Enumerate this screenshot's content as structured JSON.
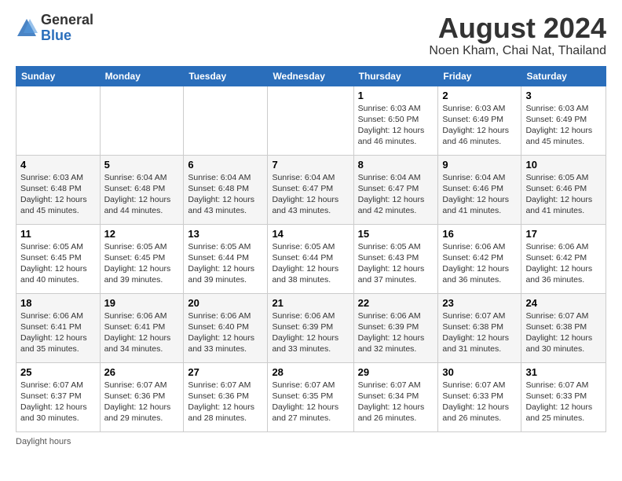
{
  "logo": {
    "general": "General",
    "blue": "Blue"
  },
  "title": "August 2024",
  "location": "Noen Kham, Chai Nat, Thailand",
  "days_of_week": [
    "Sunday",
    "Monday",
    "Tuesday",
    "Wednesday",
    "Thursday",
    "Friday",
    "Saturday"
  ],
  "footer": "Daylight hours",
  "weeks": [
    [
      {
        "day": "",
        "detail": ""
      },
      {
        "day": "",
        "detail": ""
      },
      {
        "day": "",
        "detail": ""
      },
      {
        "day": "",
        "detail": ""
      },
      {
        "day": "1",
        "detail": "Sunrise: 6:03 AM\nSunset: 6:50 PM\nDaylight: 12 hours\nand 46 minutes."
      },
      {
        "day": "2",
        "detail": "Sunrise: 6:03 AM\nSunset: 6:49 PM\nDaylight: 12 hours\nand 46 minutes."
      },
      {
        "day": "3",
        "detail": "Sunrise: 6:03 AM\nSunset: 6:49 PM\nDaylight: 12 hours\nand 45 minutes."
      }
    ],
    [
      {
        "day": "4",
        "detail": "Sunrise: 6:03 AM\nSunset: 6:48 PM\nDaylight: 12 hours\nand 45 minutes."
      },
      {
        "day": "5",
        "detail": "Sunrise: 6:04 AM\nSunset: 6:48 PM\nDaylight: 12 hours\nand 44 minutes."
      },
      {
        "day": "6",
        "detail": "Sunrise: 6:04 AM\nSunset: 6:48 PM\nDaylight: 12 hours\nand 43 minutes."
      },
      {
        "day": "7",
        "detail": "Sunrise: 6:04 AM\nSunset: 6:47 PM\nDaylight: 12 hours\nand 43 minutes."
      },
      {
        "day": "8",
        "detail": "Sunrise: 6:04 AM\nSunset: 6:47 PM\nDaylight: 12 hours\nand 42 minutes."
      },
      {
        "day": "9",
        "detail": "Sunrise: 6:04 AM\nSunset: 6:46 PM\nDaylight: 12 hours\nand 41 minutes."
      },
      {
        "day": "10",
        "detail": "Sunrise: 6:05 AM\nSunset: 6:46 PM\nDaylight: 12 hours\nand 41 minutes."
      }
    ],
    [
      {
        "day": "11",
        "detail": "Sunrise: 6:05 AM\nSunset: 6:45 PM\nDaylight: 12 hours\nand 40 minutes."
      },
      {
        "day": "12",
        "detail": "Sunrise: 6:05 AM\nSunset: 6:45 PM\nDaylight: 12 hours\nand 39 minutes."
      },
      {
        "day": "13",
        "detail": "Sunrise: 6:05 AM\nSunset: 6:44 PM\nDaylight: 12 hours\nand 39 minutes."
      },
      {
        "day": "14",
        "detail": "Sunrise: 6:05 AM\nSunset: 6:44 PM\nDaylight: 12 hours\nand 38 minutes."
      },
      {
        "day": "15",
        "detail": "Sunrise: 6:05 AM\nSunset: 6:43 PM\nDaylight: 12 hours\nand 37 minutes."
      },
      {
        "day": "16",
        "detail": "Sunrise: 6:06 AM\nSunset: 6:42 PM\nDaylight: 12 hours\nand 36 minutes."
      },
      {
        "day": "17",
        "detail": "Sunrise: 6:06 AM\nSunset: 6:42 PM\nDaylight: 12 hours\nand 36 minutes."
      }
    ],
    [
      {
        "day": "18",
        "detail": "Sunrise: 6:06 AM\nSunset: 6:41 PM\nDaylight: 12 hours\nand 35 minutes."
      },
      {
        "day": "19",
        "detail": "Sunrise: 6:06 AM\nSunset: 6:41 PM\nDaylight: 12 hours\nand 34 minutes."
      },
      {
        "day": "20",
        "detail": "Sunrise: 6:06 AM\nSunset: 6:40 PM\nDaylight: 12 hours\nand 33 minutes."
      },
      {
        "day": "21",
        "detail": "Sunrise: 6:06 AM\nSunset: 6:39 PM\nDaylight: 12 hours\nand 33 minutes."
      },
      {
        "day": "22",
        "detail": "Sunrise: 6:06 AM\nSunset: 6:39 PM\nDaylight: 12 hours\nand 32 minutes."
      },
      {
        "day": "23",
        "detail": "Sunrise: 6:07 AM\nSunset: 6:38 PM\nDaylight: 12 hours\nand 31 minutes."
      },
      {
        "day": "24",
        "detail": "Sunrise: 6:07 AM\nSunset: 6:38 PM\nDaylight: 12 hours\nand 30 minutes."
      }
    ],
    [
      {
        "day": "25",
        "detail": "Sunrise: 6:07 AM\nSunset: 6:37 PM\nDaylight: 12 hours\nand 30 minutes."
      },
      {
        "day": "26",
        "detail": "Sunrise: 6:07 AM\nSunset: 6:36 PM\nDaylight: 12 hours\nand 29 minutes."
      },
      {
        "day": "27",
        "detail": "Sunrise: 6:07 AM\nSunset: 6:36 PM\nDaylight: 12 hours\nand 28 minutes."
      },
      {
        "day": "28",
        "detail": "Sunrise: 6:07 AM\nSunset: 6:35 PM\nDaylight: 12 hours\nand 27 minutes."
      },
      {
        "day": "29",
        "detail": "Sunrise: 6:07 AM\nSunset: 6:34 PM\nDaylight: 12 hours\nand 26 minutes."
      },
      {
        "day": "30",
        "detail": "Sunrise: 6:07 AM\nSunset: 6:33 PM\nDaylight: 12 hours\nand 26 minutes."
      },
      {
        "day": "31",
        "detail": "Sunrise: 6:07 AM\nSunset: 6:33 PM\nDaylight: 12 hours\nand 25 minutes."
      }
    ]
  ]
}
